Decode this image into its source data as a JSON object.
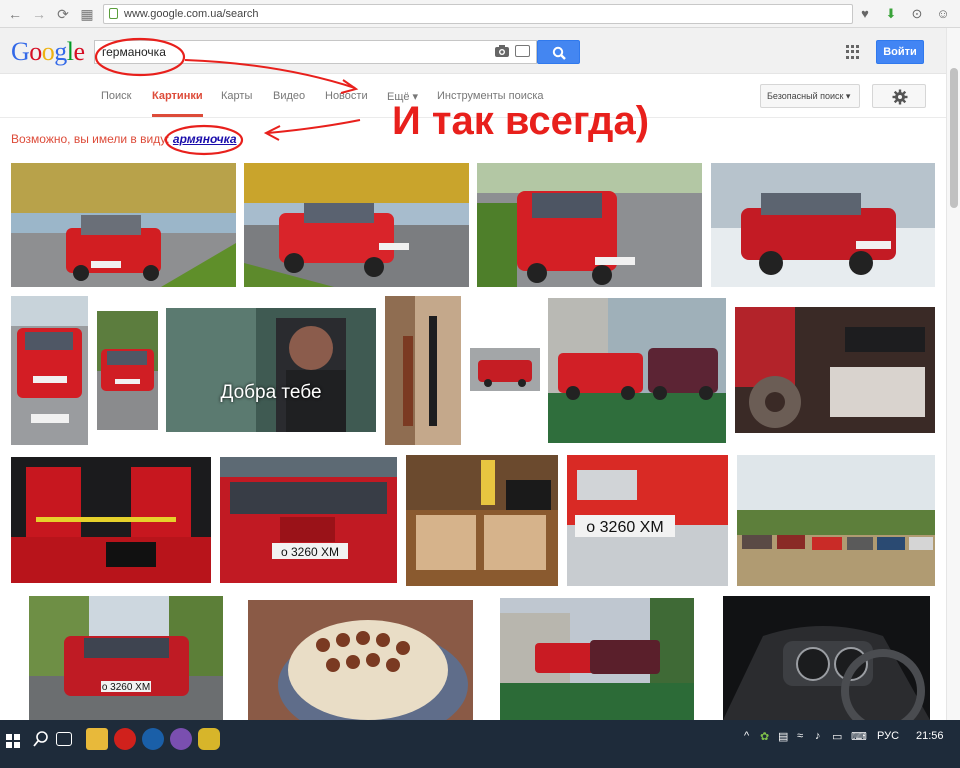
{
  "browser": {
    "url": "www.google.com.ua/search"
  },
  "google": {
    "logo_letters": [
      "G",
      "o",
      "o",
      "g",
      "l",
      "e"
    ],
    "logo_colors": [
      "#3369e8",
      "#d50f25",
      "#eeb211",
      "#3369e8",
      "#009925",
      "#d50f25"
    ],
    "query": "германочка",
    "signin_label": "Войти"
  },
  "tabs": [
    {
      "label": "Поиск"
    },
    {
      "label": "Картинки"
    },
    {
      "label": "Карты"
    },
    {
      "label": "Видео"
    },
    {
      "label": "Новости"
    },
    {
      "label": "Ещё ▾"
    },
    {
      "label": "Инструменты поиска"
    }
  ],
  "safe_search_label": "Безопасный поиск ▾",
  "did_you_mean": {
    "prefix": "Возможно, вы имели в виду:",
    "suggestion": "армяночка"
  },
  "annotation": {
    "text": "И так всегда)"
  },
  "images": {
    "caption": "Добра тебе",
    "plate": "о 3260 ХМ"
  },
  "taskbar": {
    "lang": "РУС",
    "time": "21:56"
  },
  "colors": {
    "accent_red": "#dd4b39",
    "link_blue": "#1a0dab",
    "button_blue": "#4285f4",
    "annotation_red": "#e8201c"
  }
}
